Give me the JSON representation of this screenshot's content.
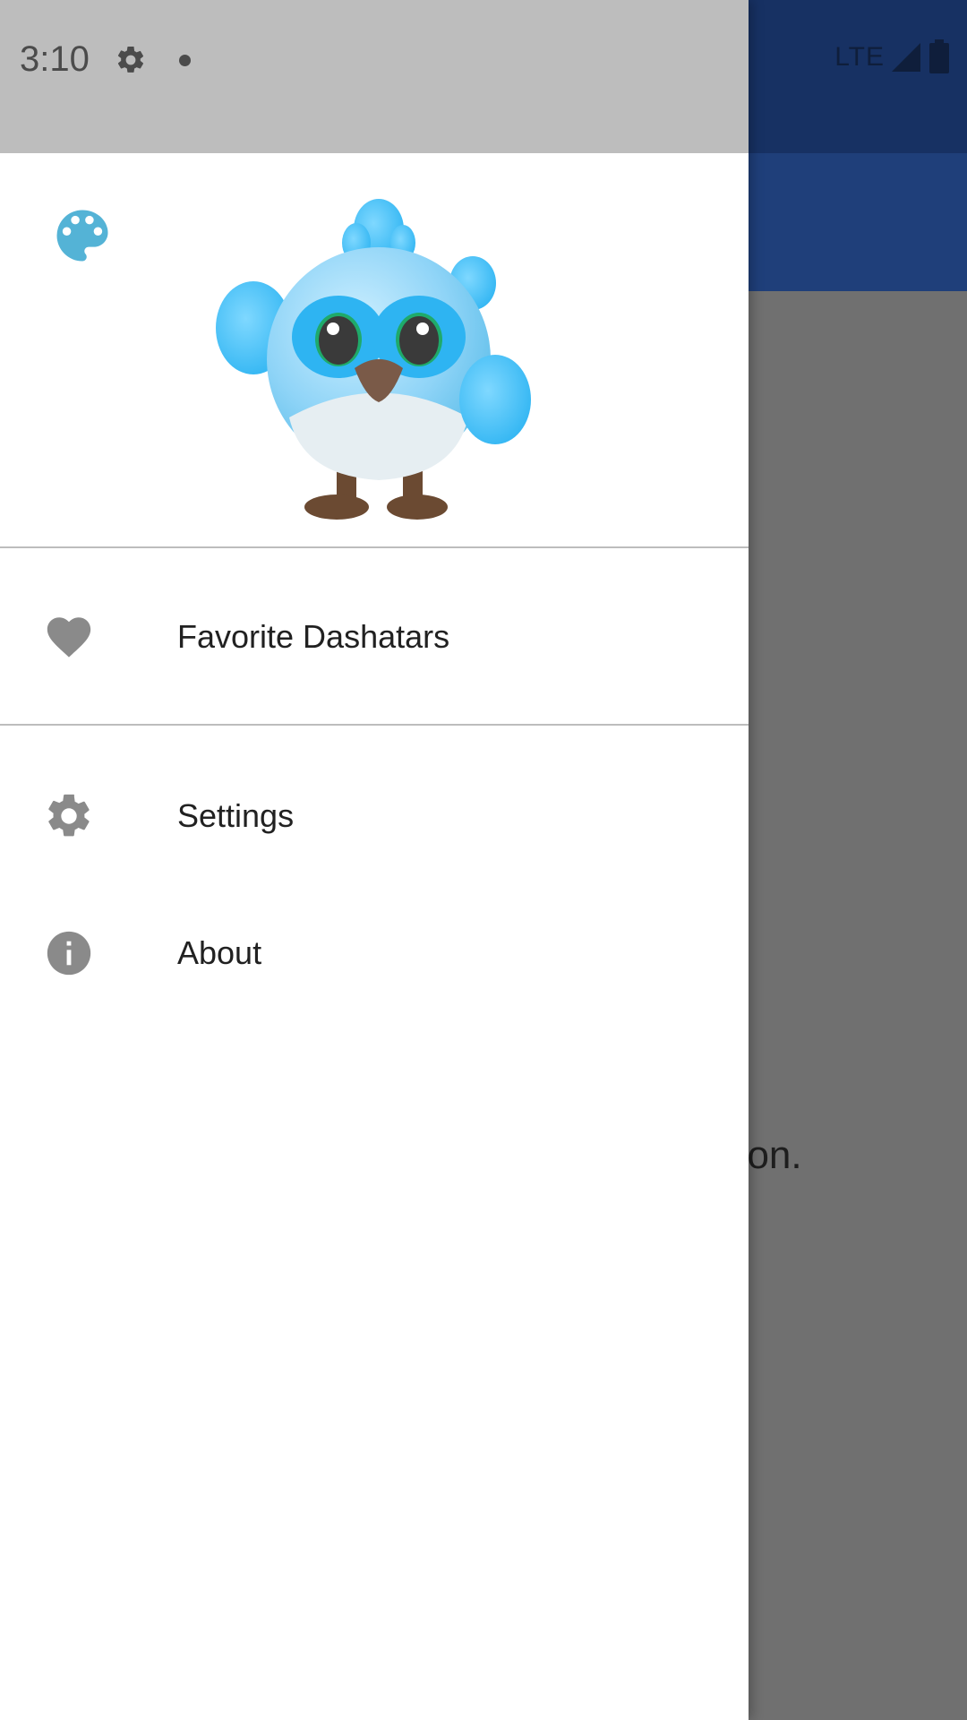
{
  "status_bar": {
    "time": "3:10",
    "network": "LTE"
  },
  "background_app": {
    "partial_text": "tton.",
    "filter_icon": "filter-icon"
  },
  "drawer": {
    "header": {
      "palette_icon": "palette-icon",
      "mascot": "dash-mascot"
    },
    "items": [
      {
        "label": "Favorite Dashatars",
        "icon": "heart-icon"
      },
      {
        "label": "Settings",
        "icon": "gear-icon"
      },
      {
        "label": "About",
        "icon": "info-icon"
      }
    ]
  },
  "colors": {
    "palette_accent": "#54b3d6",
    "icon_gray": "#8a8a8a",
    "app_bar": "#1f3f7a",
    "status_bar_bg": "#173163"
  }
}
